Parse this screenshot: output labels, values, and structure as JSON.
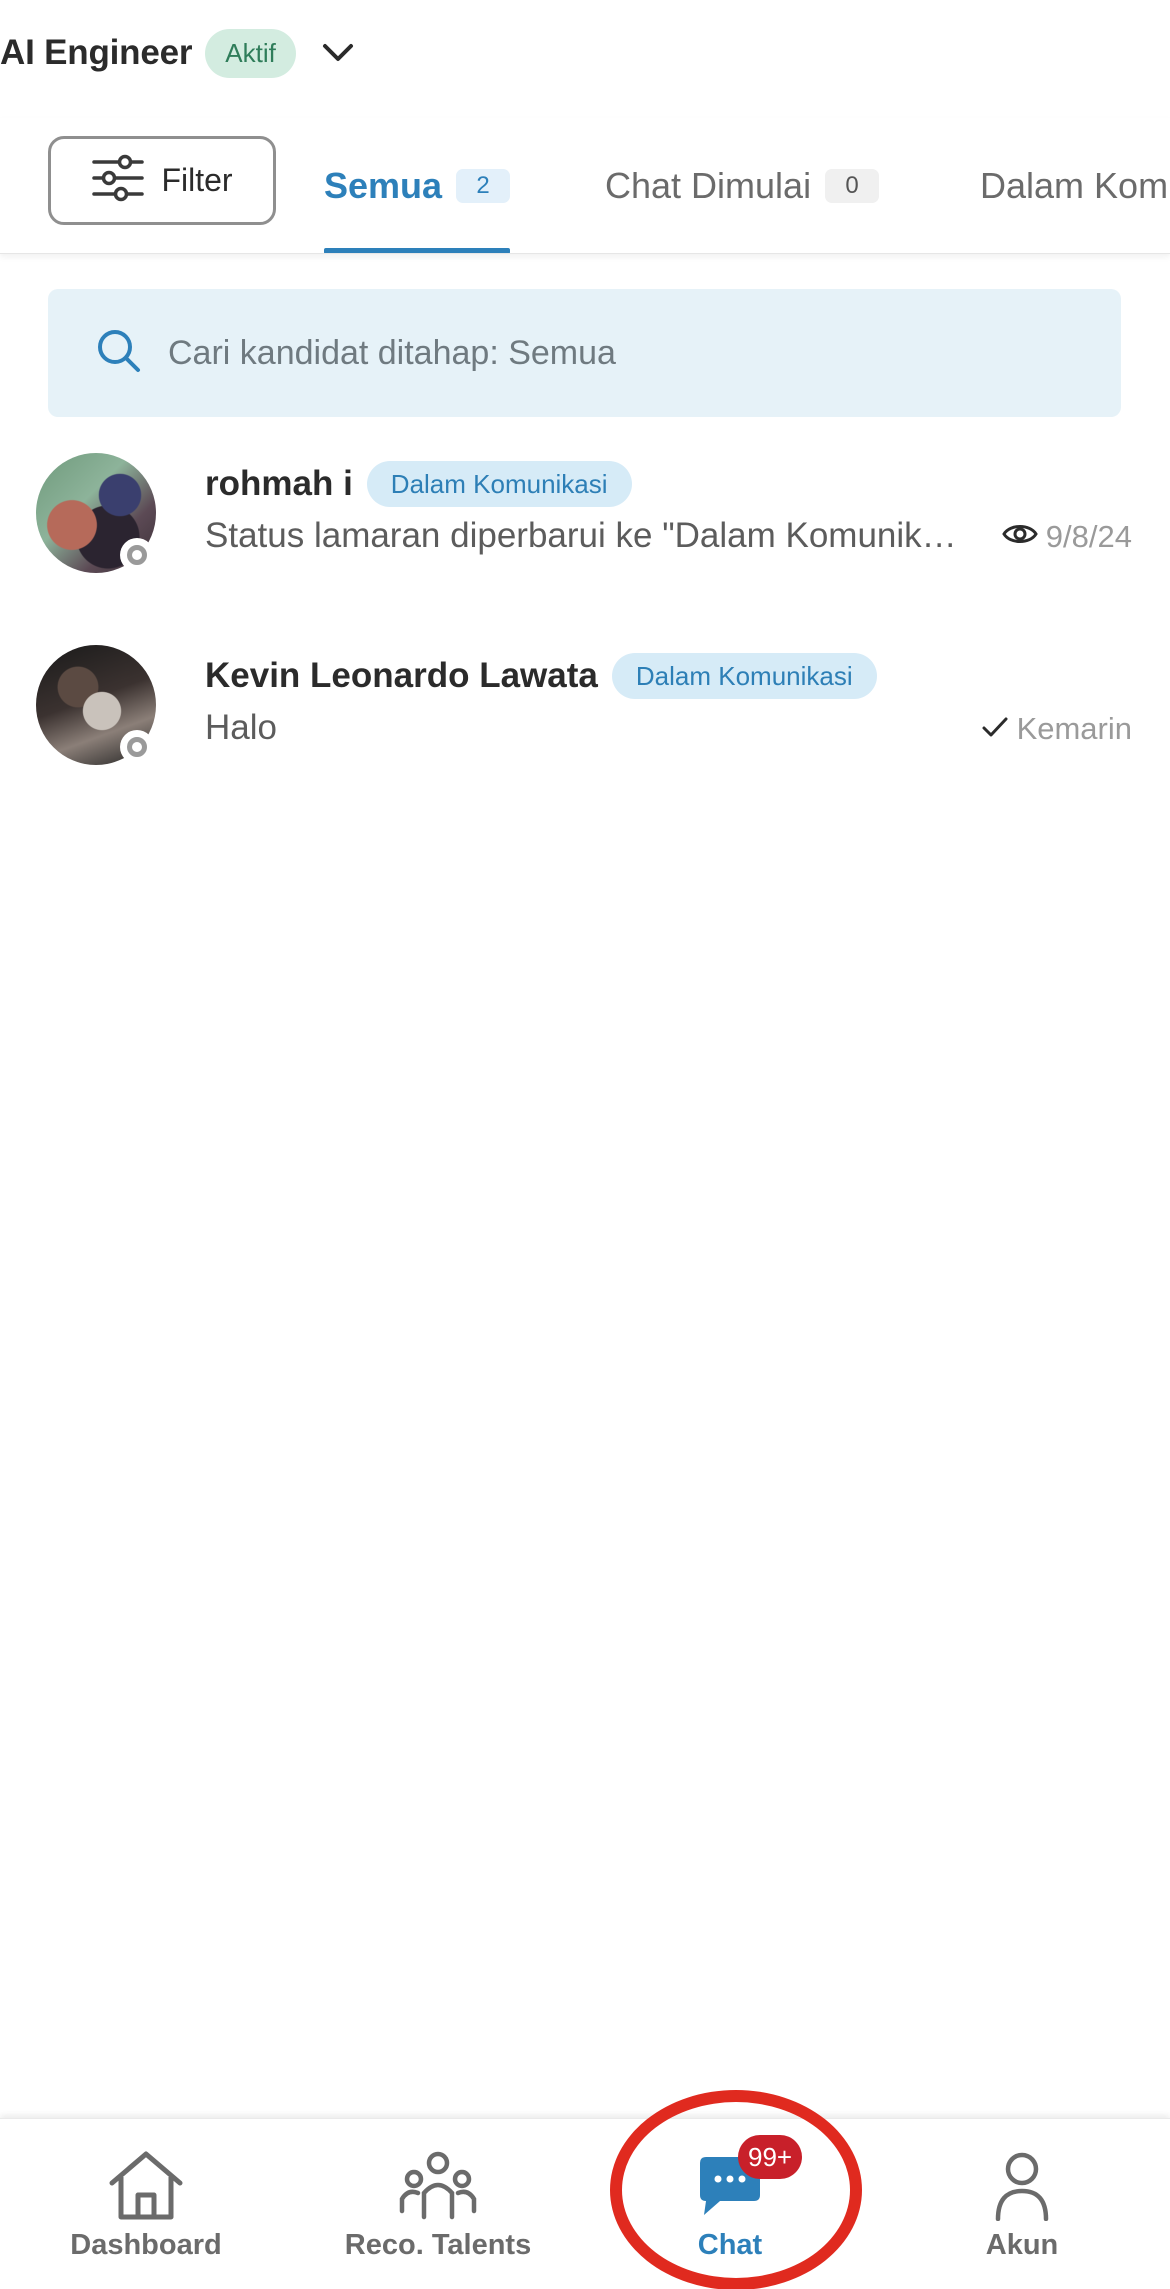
{
  "header": {
    "job_title": "AI Engineer",
    "job_status": "Aktif"
  },
  "filter": {
    "label": "Filter"
  },
  "tabs": [
    {
      "label": "Semua",
      "count": "2",
      "active": true
    },
    {
      "label": "Chat Dimulai",
      "count": "0",
      "active": false
    },
    {
      "label": "Dalam Kom",
      "count": "",
      "active": false
    }
  ],
  "search": {
    "placeholder": "Cari kandidat ditahap: Semua"
  },
  "chats": [
    {
      "name": "rohmah i",
      "stage": "Dalam Komunikasi",
      "preview": "Status lamaran diperbarui ke \"Dalam Komunikasi\"",
      "time": "9/8/24",
      "read_icon": "eye-icon"
    },
    {
      "name": "Kevin Leonardo Lawata",
      "stage": "Dalam Komunikasi",
      "preview": "Halo",
      "time": "Kemarin",
      "read_icon": "check-icon"
    }
  ],
  "bottom_nav": [
    {
      "label": "Dashboard",
      "icon": "home-icon",
      "active": false
    },
    {
      "label": "Reco. Talents",
      "icon": "people-icon",
      "active": false
    },
    {
      "label": "Chat",
      "icon": "chat-icon",
      "active": true,
      "badge": "99+"
    },
    {
      "label": "Akun",
      "icon": "person-icon",
      "active": false
    }
  ],
  "colors": {
    "accent": "#2d80ba",
    "active_badge_bg": "#d3ece0",
    "stage_badge_bg": "#d6ebf7",
    "search_bg": "#e6f2f8",
    "notification_badge": "#c8202a",
    "highlight_ring": "#e02a1f"
  }
}
